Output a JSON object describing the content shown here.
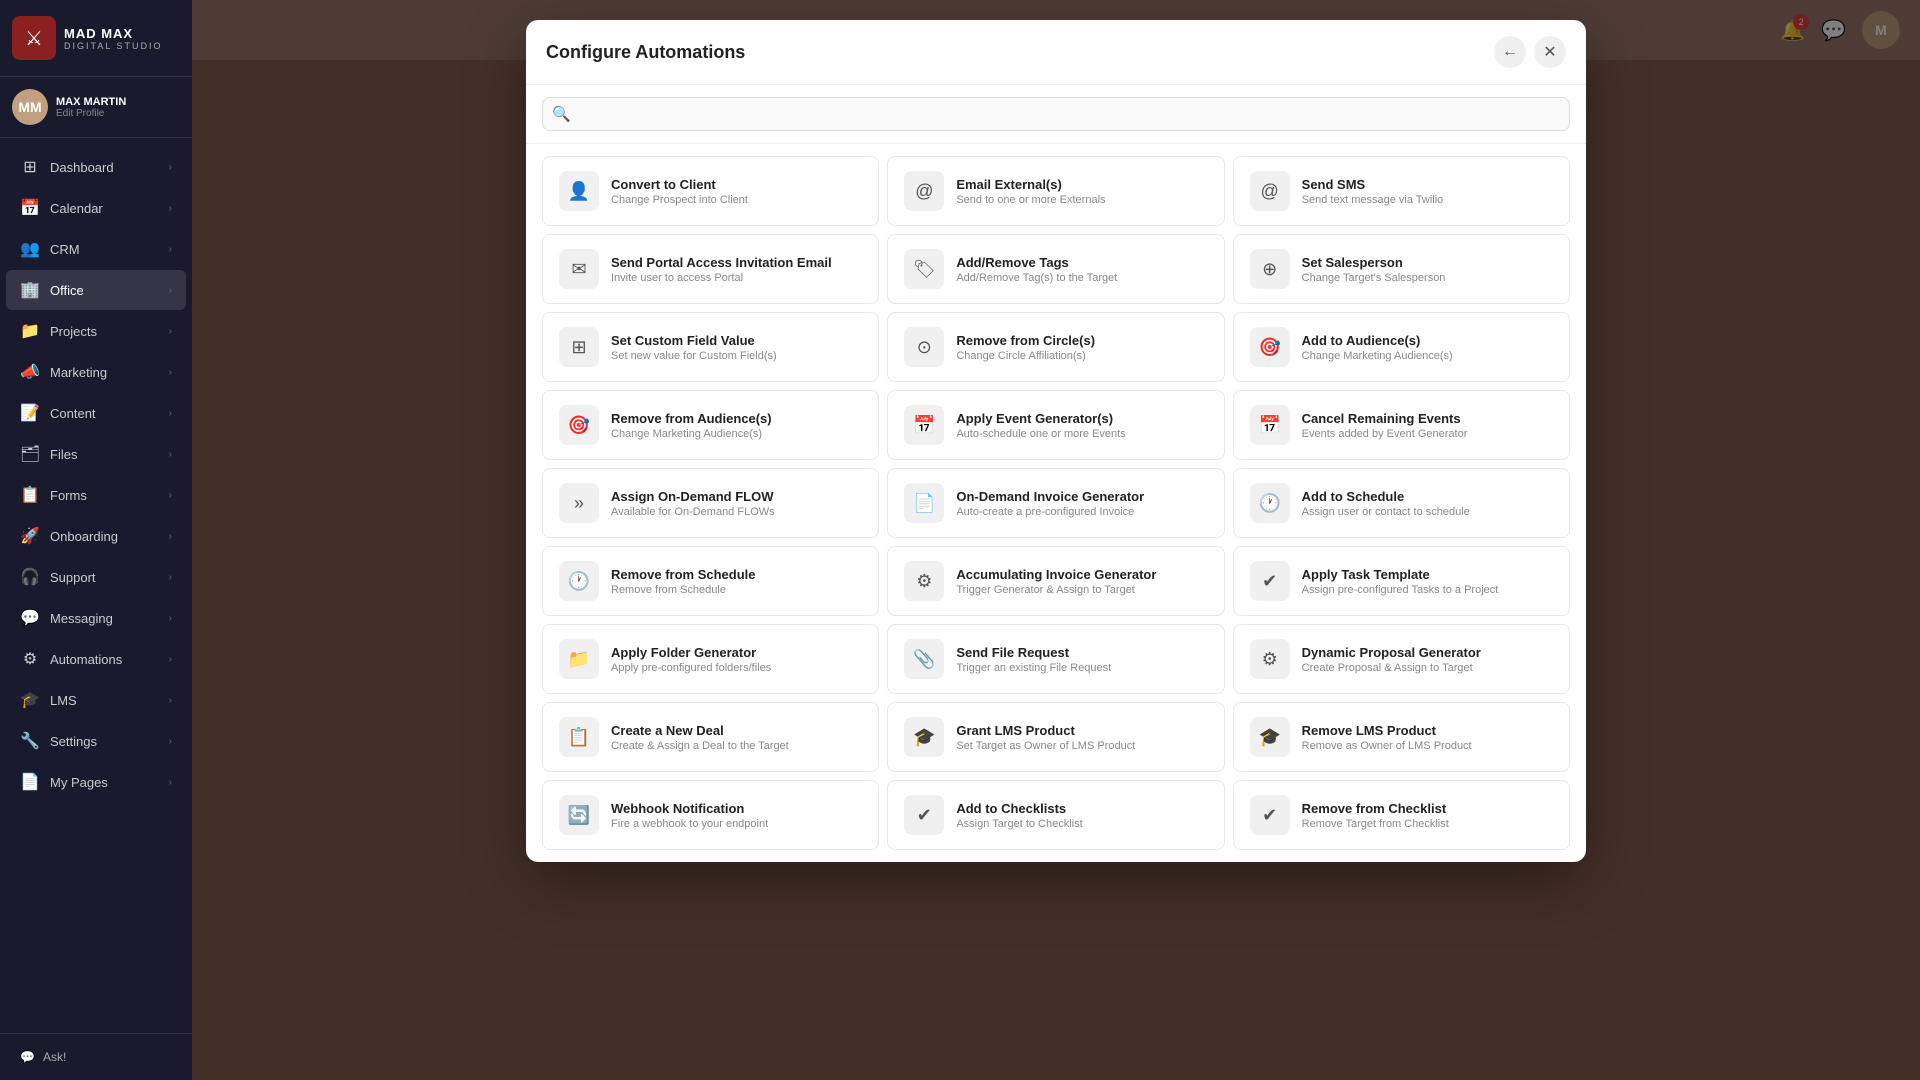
{
  "app": {
    "brand": "MAD MAX",
    "sub": "digital studio"
  },
  "user": {
    "name": "MAX MARTIN",
    "edit_label": "Edit Profile",
    "initials": "MM"
  },
  "sidebar": {
    "items": [
      {
        "id": "dashboard",
        "label": "Dashboard",
        "icon": "⊞",
        "has_children": true
      },
      {
        "id": "calendar",
        "label": "Calendar",
        "icon": "📅",
        "has_children": true
      },
      {
        "id": "crm",
        "label": "CRM",
        "icon": "👥",
        "has_children": true
      },
      {
        "id": "office",
        "label": "Office",
        "icon": "🏢",
        "has_children": true,
        "active": true
      },
      {
        "id": "projects",
        "label": "Projects",
        "icon": "📁",
        "has_children": true
      },
      {
        "id": "marketing",
        "label": "Marketing",
        "icon": "📣",
        "has_children": true
      },
      {
        "id": "content",
        "label": "Content",
        "icon": "📝",
        "has_children": true
      },
      {
        "id": "files",
        "label": "Files",
        "icon": "🗂",
        "has_children": true
      },
      {
        "id": "forms",
        "label": "Forms",
        "icon": "📋",
        "has_children": true
      },
      {
        "id": "onboarding",
        "label": "Onboarding",
        "icon": "🚀",
        "has_children": true
      },
      {
        "id": "support",
        "label": "Support",
        "icon": "🎧",
        "has_children": true
      },
      {
        "id": "messaging",
        "label": "Messaging",
        "icon": "💬",
        "has_children": true
      },
      {
        "id": "automations",
        "label": "Automations",
        "icon": "⚙",
        "has_children": true
      },
      {
        "id": "lms",
        "label": "LMS",
        "icon": "🎓",
        "has_children": true
      },
      {
        "id": "settings",
        "label": "Settings",
        "icon": "🔧",
        "has_children": true
      },
      {
        "id": "mypages",
        "label": "My Pages",
        "icon": "📄",
        "has_children": true
      }
    ],
    "ask_label": "Ask!"
  },
  "modal": {
    "title": "Configure Automations",
    "search_placeholder": "",
    "back_icon": "←",
    "close_icon": "✕",
    "automations": [
      {
        "id": "convert-to-client",
        "title": "Convert to Client",
        "desc": "Change Prospect into Client",
        "icon": "👤"
      },
      {
        "id": "email-externals",
        "title": "Email External(s)",
        "desc": "Send to one or more Externals",
        "icon": "@"
      },
      {
        "id": "send-sms",
        "title": "Send SMS",
        "desc": "Send text message via Twilio",
        "icon": "@"
      },
      {
        "id": "send-portal-access",
        "title": "Send Portal Access Invitation Email",
        "desc": "Invite user to access Portal",
        "icon": "✉"
      },
      {
        "id": "add-remove-tags",
        "title": "Add/Remove Tags",
        "desc": "Add/Remove Tag(s) to the Target",
        "icon": "🏷"
      },
      {
        "id": "set-salesperson",
        "title": "Set Salesperson",
        "desc": "Change Target's Salesperson",
        "icon": "⊕"
      },
      {
        "id": "set-custom-field",
        "title": "Set Custom Field Value",
        "desc": "Set new value for Custom Field(s)",
        "icon": "⊞"
      },
      {
        "id": "remove-from-circles",
        "title": "Remove from Circle(s)",
        "desc": "Change Circle Affiliation(s)",
        "icon": "⊙"
      },
      {
        "id": "add-to-audiences",
        "title": "Add to Audience(s)",
        "desc": "Change Marketing Audience(s)",
        "icon": "🎯"
      },
      {
        "id": "remove-from-audiences",
        "title": "Remove from Audience(s)",
        "desc": "Change Marketing Audience(s)",
        "icon": "🎯"
      },
      {
        "id": "apply-event-generator",
        "title": "Apply Event Generator(s)",
        "desc": "Auto-schedule one or more Events",
        "icon": "📅"
      },
      {
        "id": "cancel-remaining-events",
        "title": "Cancel Remaining Events",
        "desc": "Events added by Event Generator",
        "icon": "📅"
      },
      {
        "id": "assign-on-demand-flow",
        "title": "Assign On-Demand FLOW",
        "desc": "Available for On-Demand FLOWs",
        "icon": "»"
      },
      {
        "id": "on-demand-invoice-generator",
        "title": "On-Demand Invoice Generator",
        "desc": "Auto-create a pre-configured Invoice",
        "icon": "📄"
      },
      {
        "id": "add-to-schedule",
        "title": "Add to Schedule",
        "desc": "Assign user or contact to schedule",
        "icon": "🕐"
      },
      {
        "id": "remove-from-schedule",
        "title": "Remove from Schedule",
        "desc": "Remove from Schedule",
        "icon": "🕐"
      },
      {
        "id": "accumulating-invoice-generator",
        "title": "Accumulating Invoice Generator",
        "desc": "Trigger Generator & Assign to Target",
        "icon": "⚙"
      },
      {
        "id": "apply-task-template",
        "title": "Apply Task Template",
        "desc": "Assign pre-configured Tasks to a Project",
        "icon": "✔"
      },
      {
        "id": "apply-folder-generator",
        "title": "Apply Folder Generator",
        "desc": "Apply pre-configured folders/files",
        "icon": "📁"
      },
      {
        "id": "send-file-request",
        "title": "Send File Request",
        "desc": "Trigger an existing File Request",
        "icon": "📎"
      },
      {
        "id": "dynamic-proposal-generator",
        "title": "Dynamic Proposal Generator",
        "desc": "Create Proposal & Assign to Target",
        "icon": "⚙"
      },
      {
        "id": "create-new-deal",
        "title": "Create a New Deal",
        "desc": "Create & Assign a Deal to the Target",
        "icon": "📋"
      },
      {
        "id": "grant-lms-product",
        "title": "Grant LMS Product",
        "desc": "Set Target as Owner of LMS Product",
        "icon": "🎓"
      },
      {
        "id": "remove-lms-product",
        "title": "Remove LMS Product",
        "desc": "Remove as Owner of LMS Product",
        "icon": "🎓"
      },
      {
        "id": "webhook-notification",
        "title": "Webhook Notification",
        "desc": "Fire a webhook to your endpoint",
        "icon": "🔄"
      },
      {
        "id": "add-to-checklists",
        "title": "Add to Checklists",
        "desc": "Assign Target to Checklist",
        "icon": "✔"
      },
      {
        "id": "remove-from-checklist",
        "title": "Remove from Checklist",
        "desc": "Remove Target from Checklist",
        "icon": "✔"
      }
    ]
  }
}
